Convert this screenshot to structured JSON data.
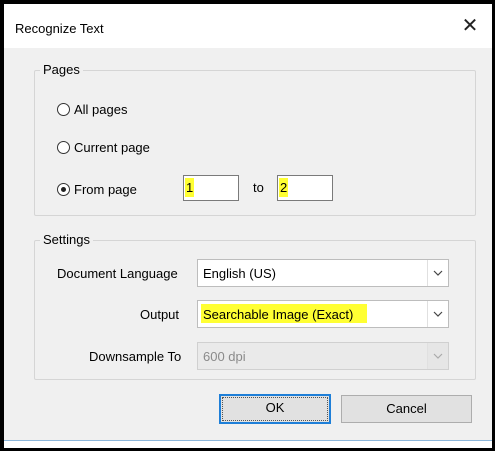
{
  "window": {
    "title": "Recognize Text"
  },
  "pages_group": {
    "legend": "Pages",
    "options": [
      {
        "label": "All pages",
        "checked": false
      },
      {
        "label": "Current page",
        "checked": false
      },
      {
        "label": "From page",
        "checked": true
      }
    ],
    "from_value": "1",
    "to_label": "to",
    "to_value": "2"
  },
  "settings_group": {
    "legend": "Settings",
    "language_label": "Document Language",
    "language_value": "English (US)",
    "output_label": "Output",
    "output_value": "Searchable Image (Exact)",
    "downsample_label": "Downsample To",
    "downsample_value": "600 dpi"
  },
  "buttons": {
    "ok": "OK",
    "cancel": "Cancel"
  },
  "colors": {
    "highlight": "#ffff33",
    "accent": "#1e7fd8"
  }
}
